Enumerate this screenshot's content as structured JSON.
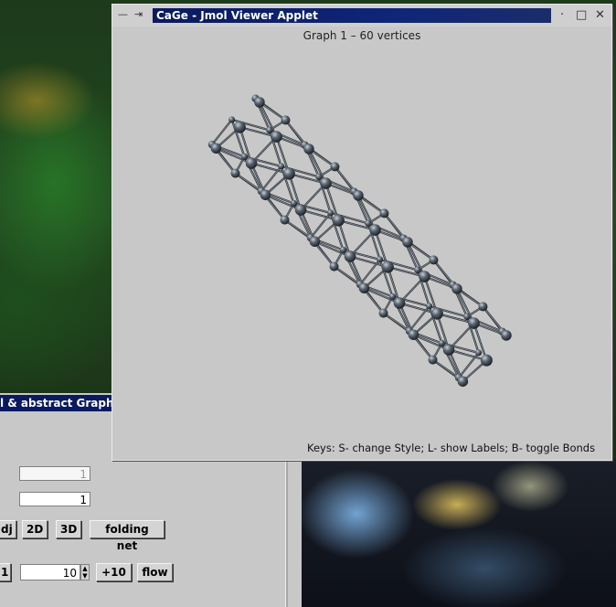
{
  "jmol_window": {
    "title": "CaGe - Jmol Viewer Applet",
    "graph_title": "Graph 1 – 60 vertices",
    "keys_hint": "Keys: S- change Style; L- show Labels; B- toggle Bonds",
    "controls": {
      "menu_icon": "—",
      "pin_icon": "⇥",
      "minimize_icon": "·",
      "maximize_icon": "□",
      "close_icon": "✕"
    },
    "atom_color": "#5a6470",
    "bond_color": "#2e3238"
  },
  "graph_editor_window": {
    "title": "l & abstract Graph e",
    "field1_value": "1",
    "field2_value": "1",
    "buttons": [
      "dj",
      "2D",
      "3D",
      "folding net"
    ],
    "step_left_label": "1",
    "step_value": "10",
    "plus_button": "+10",
    "flow_button": "flow"
  }
}
